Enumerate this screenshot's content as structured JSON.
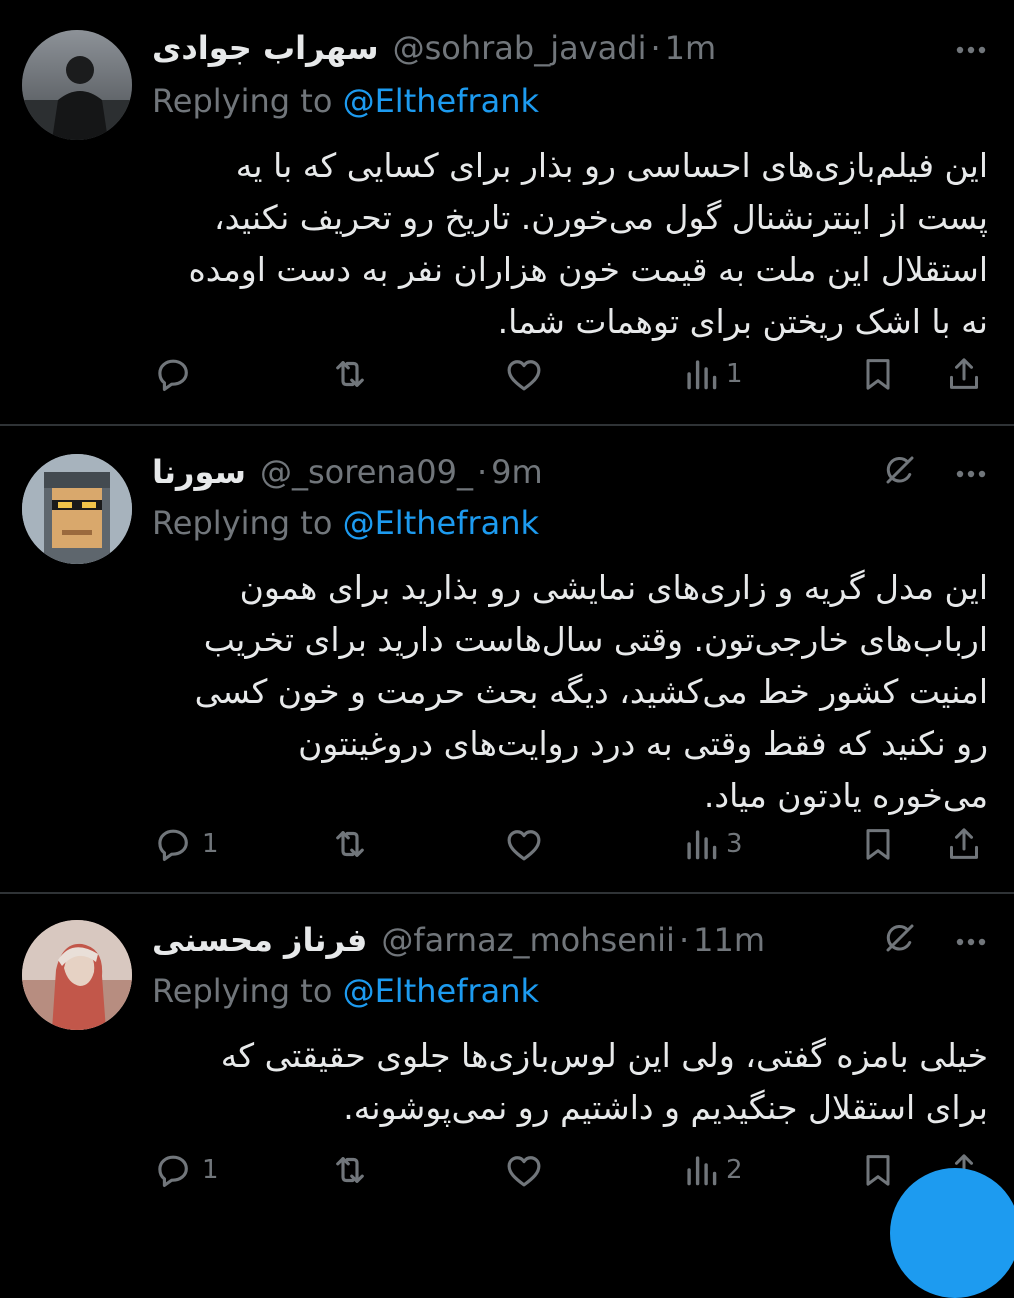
{
  "tweets": [
    {
      "name": "سهراب جوادی",
      "handle": "@sohrab_javadi",
      "sep": "·",
      "time": "1m",
      "replying_prefix": "Replying to ",
      "replying_to": "@Elthefrank",
      "text_lines": [
        "این فیلم‌بازی‌های احساسی رو بذار برای کسایی که با یه",
        "پست از اینترنشنال گول می‌خورن. تاریخ رو تحریف نکنید،",
        "استقلال این ملت به قیمت خون هزاران نفر به دست اومده",
        "نه با اشک ریختن برای توهمات شما."
      ],
      "reply_count": "",
      "views_count": "1"
    },
    {
      "name": "سورنا",
      "handle": "@_sorena09_",
      "sep": "·",
      "time": "9m",
      "replying_prefix": "Replying to ",
      "replying_to": "@Elthefrank",
      "text_lines": [
        "این مدل گریه و زاری‌های نمایشی رو بذارید برای همون",
        "ارباب‌های خارجی‌تون. وقتی سال‌هاست دارید برای تخریب",
        "امنیت کشور خط می‌کشید، دیگه بحث حرمت و خون کسی",
        "رو نکنید که فقط وقتی به درد روایت‌های دروغینتون",
        "می‌خوره یادتون میاد."
      ],
      "reply_count": "1",
      "views_count": "3"
    },
    {
      "name": "فرناز محسنی",
      "handle": "@farnaz_mohsenii",
      "sep": "·",
      "time": "11m",
      "replying_prefix": "Replying to ",
      "replying_to": "@Elthefrank",
      "text_lines": [
        "خیلی بامزه گفتی، ولی این لوس‌بازی‌ها جلوی حقیقتی که",
        "برای استقلال جنگیدیم و داشتیم رو نمی‌پوشونه."
      ],
      "reply_count": "1",
      "views_count": "2"
    }
  ],
  "icons": {
    "more": "more-icon",
    "grok": "grok-icon",
    "reply": "reply-icon",
    "retweet": "retweet-icon",
    "like": "like-icon",
    "views": "views-icon",
    "bookmark": "bookmark-icon",
    "share": "share-icon"
  },
  "colors": {
    "background": "#000000",
    "text": "#e7e9ea",
    "muted": "#71767b",
    "link": "#1d9bf0",
    "separator": "#2f3336"
  }
}
